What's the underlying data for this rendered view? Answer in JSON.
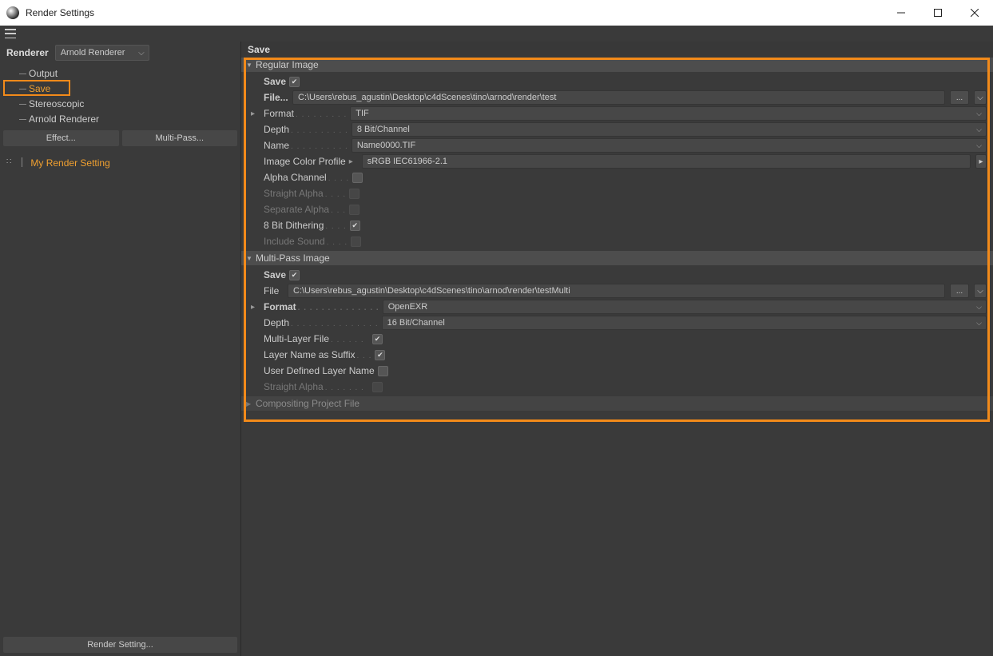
{
  "window": {
    "title": "Render Settings"
  },
  "sidebar": {
    "renderer_label": "Renderer",
    "renderer_value": "Arnold Renderer",
    "tree": [
      "Output",
      "Save",
      "Stereoscopic",
      "Arnold Renderer"
    ],
    "selected_index": 1,
    "effect_btn": "Effect...",
    "multipass_btn": "Multi-Pass...",
    "render_setting_name": "My Render Setting",
    "bottom_btn": "Render Setting..."
  },
  "panel": {
    "title": "Save",
    "regular": {
      "header": "Regular Image",
      "save_label": "Save",
      "save_checked": true,
      "file_label": "File...",
      "file_value": "C:\\Users\\rebus_agustin\\Desktop\\c4dScenes\\tino\\arnod\\render\\test",
      "format_label": "Format",
      "format_value": "TIF",
      "depth_label": "Depth",
      "depth_value": "8 Bit/Channel",
      "name_label": "Name",
      "name_value": "Name0000.TIF",
      "icp_label": "Image Color Profile",
      "icp_value": "sRGB IEC61966-2.1",
      "alpha_channel": "Alpha Channel",
      "straight_alpha": "Straight Alpha",
      "separate_alpha": "Separate Alpha",
      "dithering": "8 Bit Dithering",
      "include_sound": "Include Sound"
    },
    "multipass": {
      "header": "Multi-Pass Image",
      "save_label": "Save",
      "save_checked": true,
      "file_label": "File",
      "file_value": "C:\\Users\\rebus_agustin\\Desktop\\c4dScenes\\tino\\arnod\\render\\testMulti",
      "format_label": "Format",
      "format_value": "OpenEXR",
      "depth_label": "Depth",
      "depth_value": "16 Bit/Channel",
      "multilayer": "Multi-Layer File",
      "layer_suffix": "Layer Name as Suffix",
      "user_layer": "User Defined Layer Name",
      "straight_alpha": "Straight Alpha"
    },
    "compositing_header": "Compositing Project File"
  }
}
